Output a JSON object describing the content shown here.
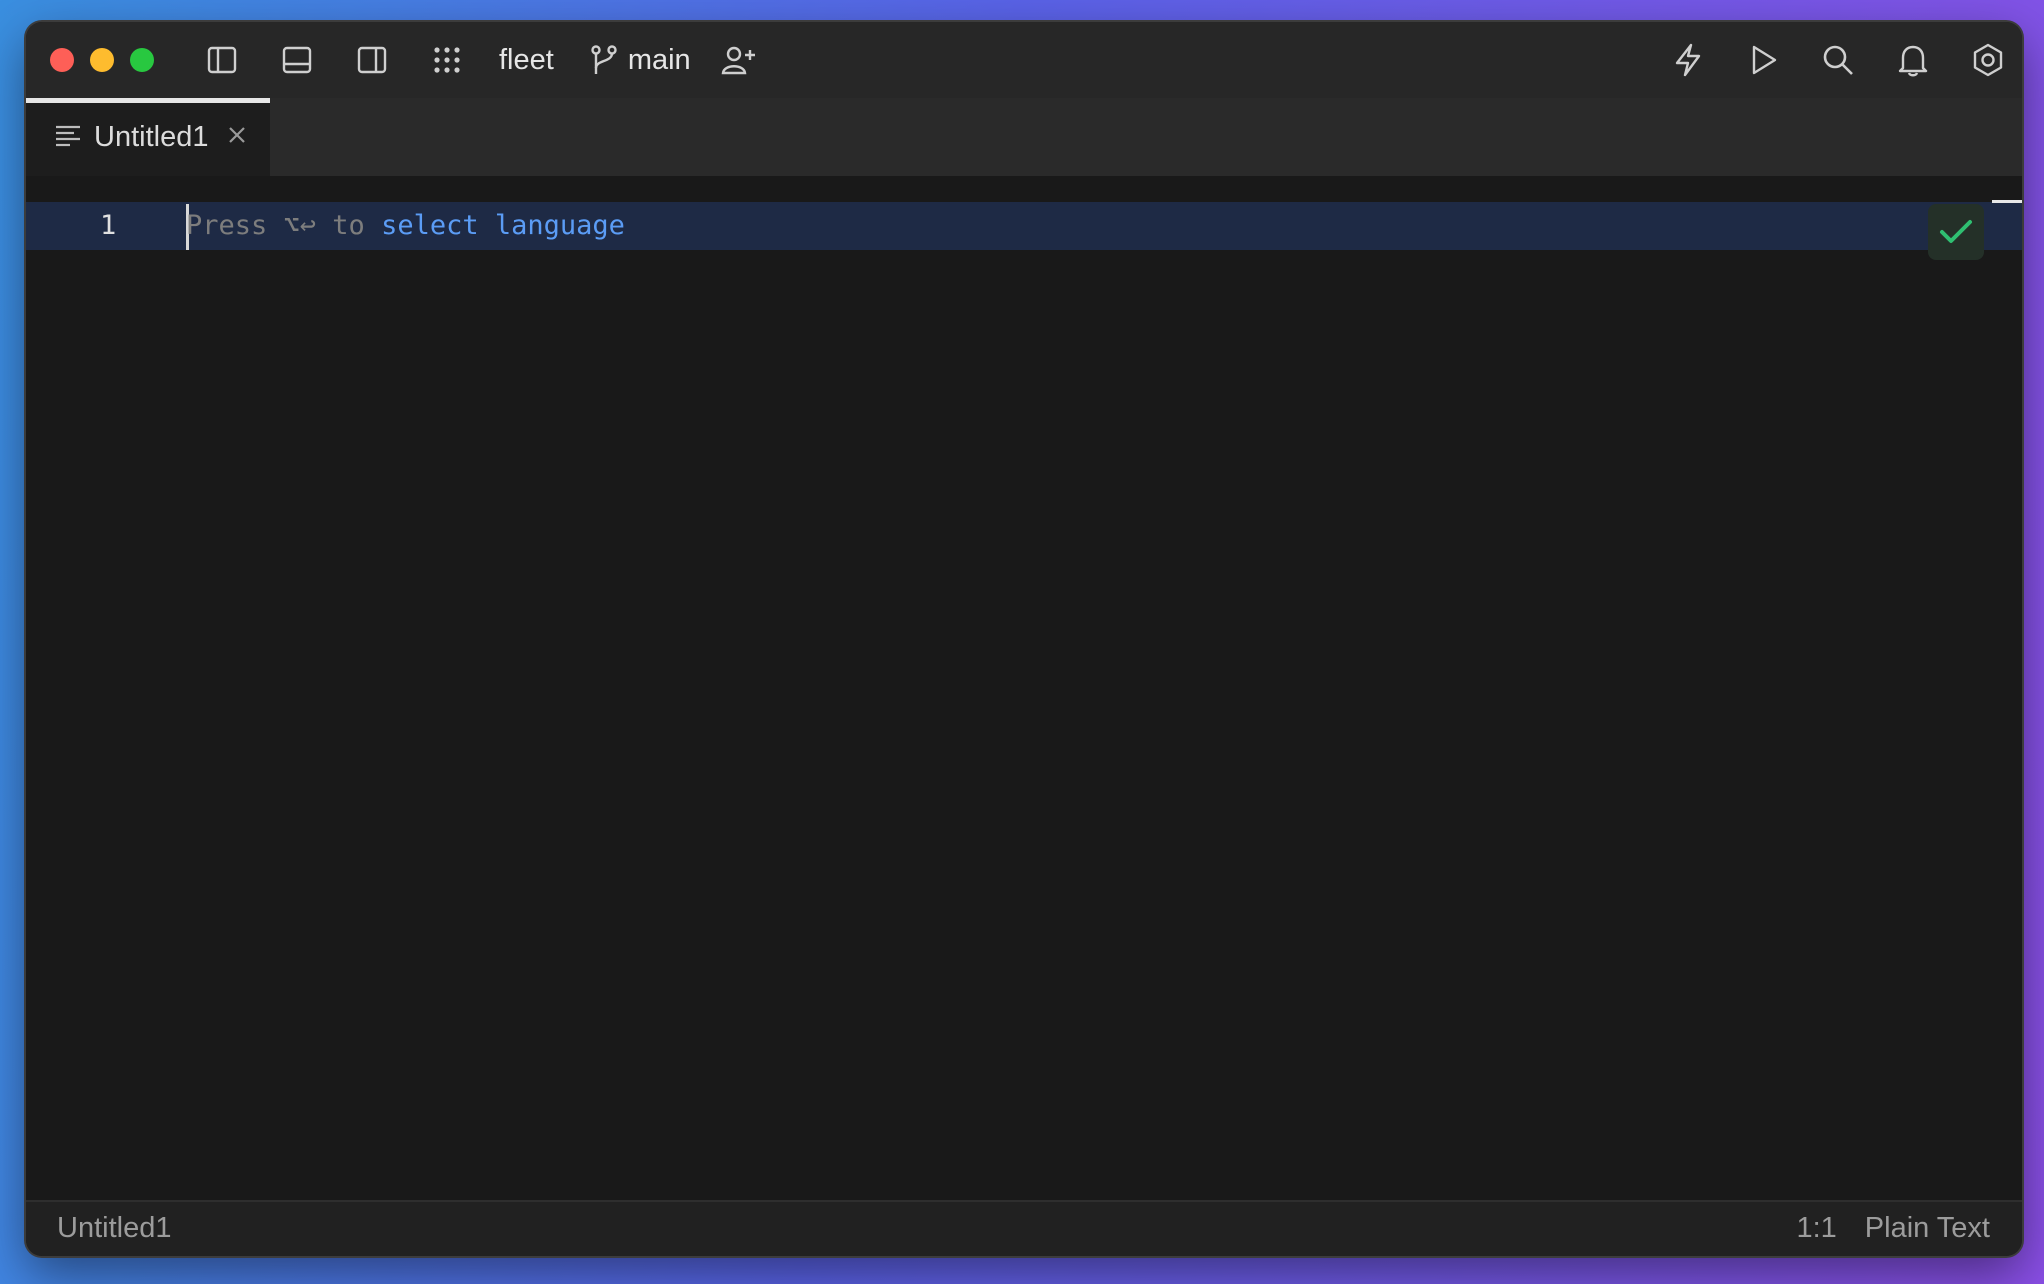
{
  "titlebar": {
    "project": "fleet",
    "branch": "main",
    "icons": {
      "left": [
        "sidebar-left-icon",
        "panel-bottom-icon",
        "sidebar-right-icon",
        "apps-grid-icon"
      ],
      "right": [
        "lightning-icon",
        "run-icon",
        "search-icon",
        "bell-icon",
        "settings-icon"
      ]
    }
  },
  "tab": {
    "label": "Untitled1"
  },
  "editor": {
    "line_number": "1",
    "hint_prefix": "Press ⌥↩ to ",
    "hint_keyword": "select language"
  },
  "statusbar": {
    "file": "Untitled1",
    "position": "1:1",
    "language": "Plain Text"
  },
  "colors": {
    "accent": "#5b9cf5",
    "check": "#2fbf71",
    "current_line": "#1e2a45"
  }
}
